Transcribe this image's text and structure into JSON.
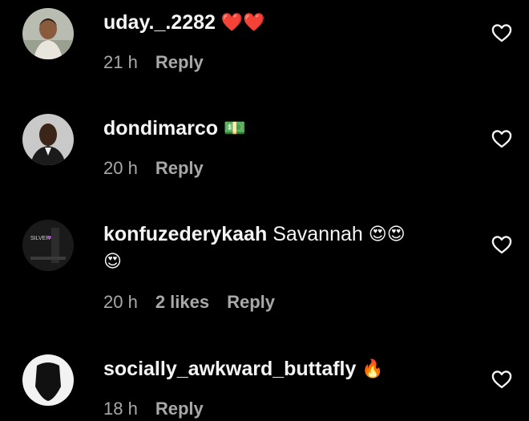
{
  "comments": [
    {
      "username": "uday._.2282",
      "text": "",
      "emoji": "❤️❤️",
      "time": "21 h",
      "likes": "",
      "reply": "Reply"
    },
    {
      "username": "dondimarco",
      "text": "",
      "emoji": "💵",
      "time": "20 h",
      "likes": "",
      "reply": "Reply"
    },
    {
      "username": "konfuzederykaah",
      "text": "Savannah",
      "emoji": "😍😍",
      "emoji_line2": "😍",
      "time": "20 h",
      "likes": "2 likes",
      "reply": "Reply",
      "avatar_caption": "SILVER"
    },
    {
      "username": "socially_awkward_buttafly",
      "text": "",
      "emoji": "🔥",
      "time": "18 h",
      "likes": "",
      "reply": "Reply"
    }
  ],
  "icons": {
    "like": "heart-outline-icon"
  },
  "colors": {
    "background": "#000000",
    "primary_text": "#f5f5f5",
    "secondary_text": "#a8a8a8"
  }
}
